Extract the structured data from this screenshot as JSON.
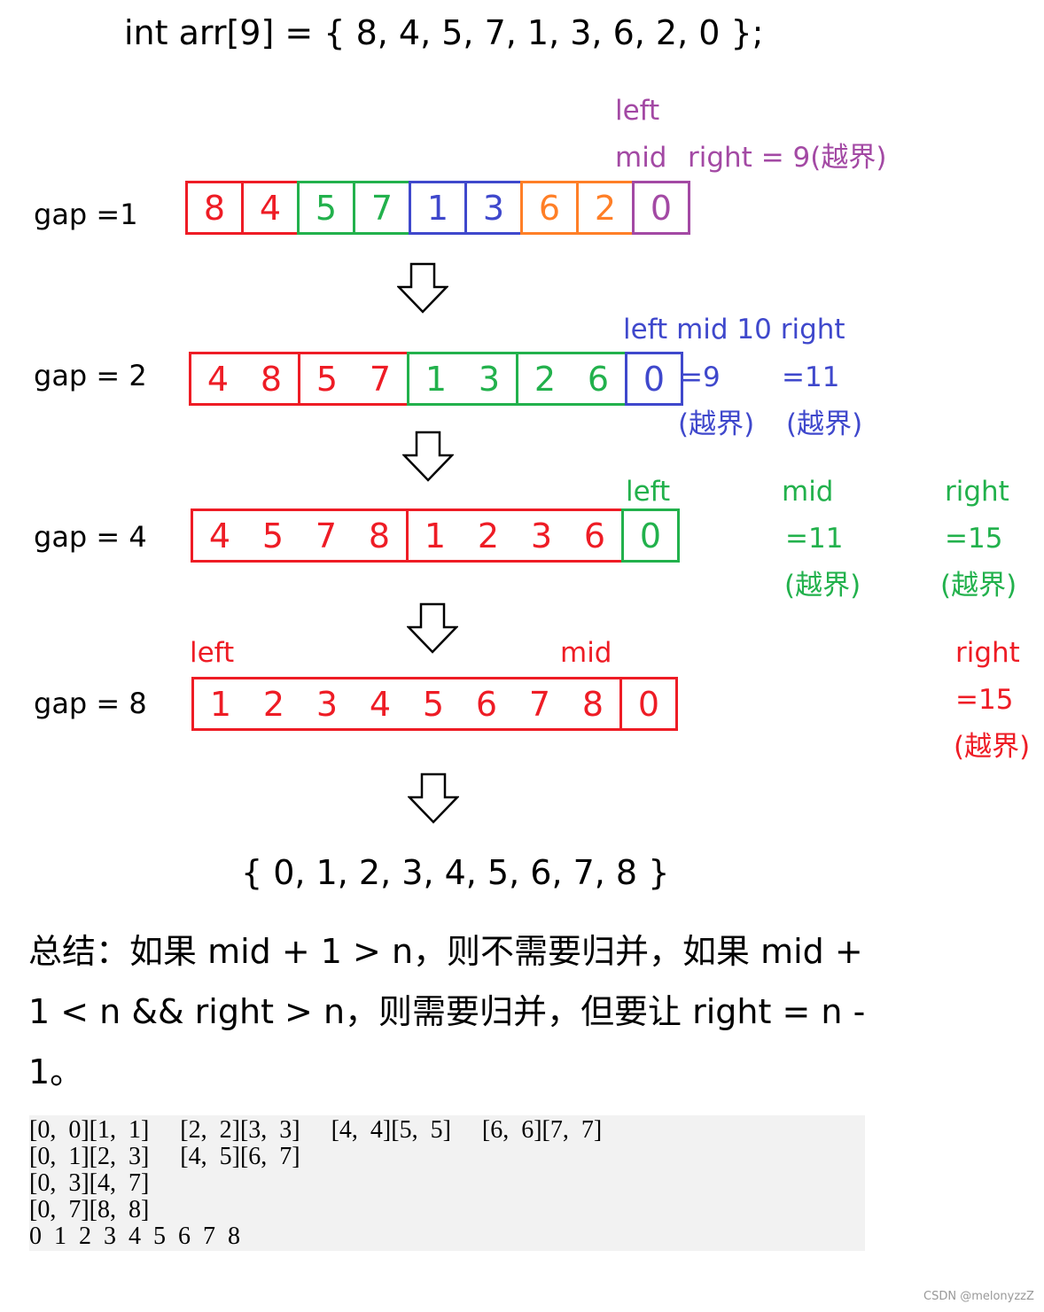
{
  "title": "int arr[9] = { 8, 4, 5, 7, 1, 3, 6, 2, 0 };",
  "colors": {
    "red": "#ee1c25",
    "green": "#22b14c",
    "blue": "#3f48cc",
    "orange": "#ff7f27",
    "purple": "#a349a4"
  },
  "rows": [
    {
      "gap_label": "gap =1",
      "groups": [
        {
          "color": "red",
          "values": [
            "8"
          ]
        },
        {
          "color": "red",
          "values": [
            "4"
          ]
        },
        {
          "color": "green",
          "values": [
            "5"
          ]
        },
        {
          "color": "green",
          "values": [
            "7"
          ]
        },
        {
          "color": "blue",
          "values": [
            "1"
          ]
        },
        {
          "color": "blue",
          "values": [
            "3"
          ]
        },
        {
          "color": "orange",
          "values": [
            "6"
          ]
        },
        {
          "color": "orange",
          "values": [
            "2"
          ]
        },
        {
          "color": "purple",
          "values": [
            "0"
          ]
        }
      ]
    },
    {
      "gap_label": "gap = 2",
      "groups": [
        {
          "color": "red",
          "values": [
            "4",
            "8"
          ]
        },
        {
          "color": "red",
          "values": [
            "5",
            "7"
          ]
        },
        {
          "color": "green",
          "values": [
            "1",
            "3"
          ]
        },
        {
          "color": "green",
          "values": [
            "2",
            "6"
          ]
        },
        {
          "color": "blue",
          "values": [
            "0"
          ]
        }
      ]
    },
    {
      "gap_label": "gap = 4",
      "groups": [
        {
          "color": "red",
          "values": [
            "4",
            "5",
            "7",
            "8"
          ]
        },
        {
          "color": "red",
          "values": [
            "1",
            "2",
            "3",
            "6"
          ]
        },
        {
          "color": "green",
          "values": [
            "0"
          ]
        }
      ]
    },
    {
      "gap_label": "gap = 8",
      "groups": [
        {
          "color": "red",
          "values": [
            "1",
            "2",
            "3",
            "4",
            "5",
            "6",
            "7",
            "8"
          ]
        },
        {
          "color": "red",
          "values": [
            "0"
          ]
        }
      ]
    }
  ],
  "annotations": {
    "r1_left": "left",
    "r1_mid": "mid",
    "r1_right": "right = 9(越界)",
    "r2_top": "left mid 10 right",
    "r2_mid_eq": "=9",
    "r2_right_eq": "=11",
    "r2_mid_oob": "(越界)",
    "r2_right_oob": "(越界)",
    "r3_left": "left",
    "r3_mid": "mid",
    "r3_right": "right",
    "r3_mid_eq": "=11",
    "r3_right_eq": "=15",
    "r3_mid_oob": "(越界)",
    "r3_right_oob": "(越界)",
    "r4_left": "left",
    "r4_mid": "mid",
    "r4_right": "right",
    "r4_right_eq": "=15",
    "r4_right_oob": "(越界)"
  },
  "result": "{ 0, 1, 2, 3, 4, 5, 6, 7, 8 }",
  "summary": "总结：如果 mid + 1 > n，则不需要归并，如果 mid + 1 < n && right > n，则需要归并，但要让 right = n - 1。",
  "code_output": [
    "[0,  0][1,  1]     [2,  2][3,  3]     [4,  4][5,  5]     [6,  6][7,  7]",
    "[0,  1][2,  3]     [4,  5][6,  7]",
    "[0,  3][4,  7]",
    "[0,  7][8,  8]",
    "0  1  2  3  4  5  6  7  8"
  ],
  "watermark": "CSDN @melonyzzZ"
}
